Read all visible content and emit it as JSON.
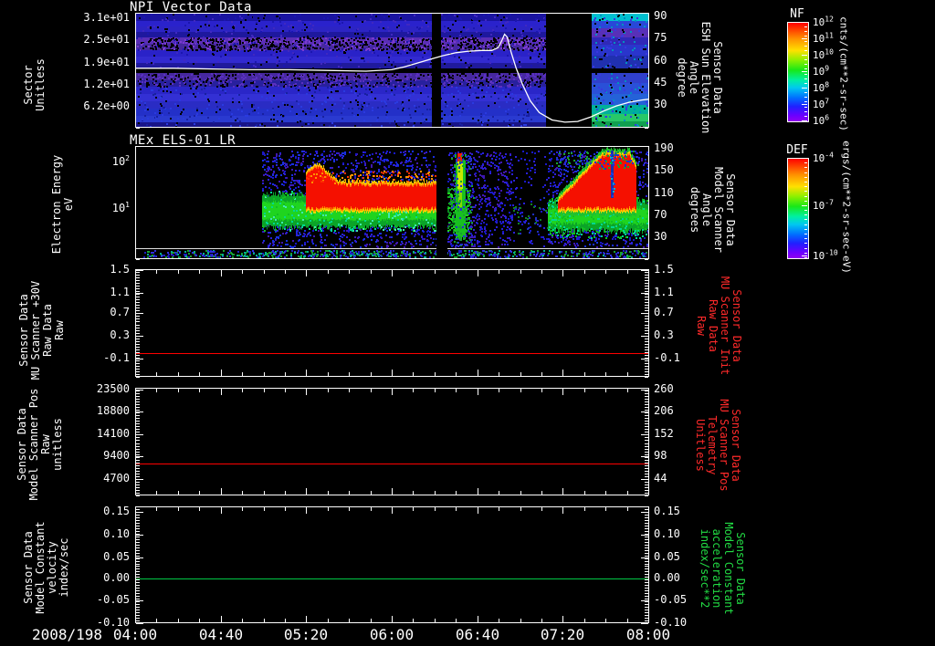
{
  "figure": {
    "bg": "#000000",
    "date_label": "2008/198",
    "time_labels": [
      "04:00",
      "04:40",
      "05:20",
      "06:00",
      "06:40",
      "07:20",
      "08:00"
    ],
    "accent_colors": {
      "white": "#ffffff",
      "red": "#ff2a2a",
      "green": "#22dd44"
    }
  },
  "chart_data": [
    {
      "id": "npi",
      "type": "heatmap",
      "title": "NPI Vector Data",
      "left_axis": {
        "lines": [
          "Sector",
          "Unitless"
        ],
        "ticks": [
          "3.1e+01",
          "2.5e+01",
          "1.9e+01",
          "1.2e+01",
          "6.2e+00"
        ],
        "tick_fracs": [
          0.048,
          0.241,
          0.434,
          0.627,
          0.82
        ],
        "color": "#ffffff"
      },
      "right_axis": {
        "lines": [
          "Sensor Data",
          "ESH Sun Elevation",
          "Angle",
          "degree"
        ],
        "ticks": [
          "90",
          "75",
          "60",
          "45",
          "30"
        ],
        "tick_fracs": [
          0.032,
          0.225,
          0.418,
          0.611,
          0.804
        ],
        "color": "#ffffff"
      },
      "overlay_line": {
        "name": "ESH Sun Elevation Angle",
        "unit": "degree",
        "color": "#ffffff",
        "deg90_frac": 0.032,
        "deg30_frac": 0.804,
        "points": [
          [
            4.0,
            55
          ],
          [
            4.3,
            55
          ],
          [
            4.6,
            54.5
          ],
          [
            4.9,
            54
          ],
          [
            5.2,
            54
          ],
          [
            5.5,
            53.5
          ],
          [
            5.8,
            53
          ],
          [
            6.0,
            54
          ],
          [
            6.1,
            56
          ],
          [
            6.2,
            58.5
          ],
          [
            6.3,
            61
          ],
          [
            6.4,
            63.5
          ],
          [
            6.5,
            65.5
          ],
          [
            6.6,
            66.5
          ],
          [
            6.7,
            67
          ],
          [
            6.78,
            67
          ],
          [
            6.83,
            69
          ],
          [
            6.86,
            74
          ],
          [
            6.88,
            78
          ],
          [
            6.9,
            76
          ],
          [
            6.93,
            66
          ],
          [
            6.97,
            55
          ],
          [
            7.02,
            44
          ],
          [
            7.08,
            33
          ],
          [
            7.15,
            25
          ],
          [
            7.25,
            20
          ],
          [
            7.35,
            18.5
          ],
          [
            7.45,
            19
          ],
          [
            7.55,
            22
          ],
          [
            7.65,
            26
          ],
          [
            7.75,
            29.5
          ],
          [
            7.85,
            32
          ],
          [
            7.95,
            33.5
          ],
          [
            8.0,
            34
          ]
        ]
      },
      "data_gaps_time": [
        [
          "06:19",
          "06:26"
        ],
        [
          "07:12",
          "07:33"
        ]
      ]
    },
    {
      "id": "els",
      "type": "heatmap",
      "title": "MEx ELS-01 LR",
      "left_axis": {
        "lines": [
          "Electron Energy",
          "eV"
        ],
        "scale": "log",
        "ticks": [
          "10^2",
          "10^1"
        ],
        "tick_fracs": [
          0.144,
          0.56
        ],
        "color": "#ffffff"
      },
      "right_axis": {
        "lines": [
          "Sensor Data",
          "Model Scanner",
          "Angle",
          "degrees"
        ],
        "ticks": [
          "190",
          "150",
          "110",
          "70",
          "30"
        ],
        "tick_fracs": [
          0.024,
          0.22,
          0.416,
          0.612,
          0.808
        ],
        "color": "#ffffff"
      },
      "data_start_time": "04:59",
      "hline_frac": 0.903,
      "data_gaps_time": [
        [
          "06:21",
          "06:27"
        ]
      ]
    },
    {
      "id": "mu-scanner-30v",
      "type": "line",
      "left_axis": {
        "lines": [
          "Sensor Data",
          "MU Scanner +30V",
          "Raw Data",
          "Raw"
        ],
        "ticks": [
          "1.5",
          "1.1",
          "0.7",
          "0.3",
          "-0.1"
        ],
        "tick_fracs": [
          0.008,
          0.22,
          0.407,
          0.619,
          0.831
        ],
        "color": "#ffffff"
      },
      "right_axis": {
        "lines": [
          "Sensor Data",
          "MU Scanner Init",
          "Raw Data",
          "Raw"
        ],
        "ticks": [
          "1.5",
          "1.1",
          "0.7",
          "0.3",
          "-0.1"
        ],
        "tick_fracs": [
          0.008,
          0.22,
          0.407,
          0.619,
          0.831
        ],
        "color": "#ff2a2a"
      },
      "series": [
        {
          "name": "MU Scanner +30V Raw",
          "color": "#ff0000",
          "constant_value": 0.0,
          "y_frac": 0.78
        }
      ]
    },
    {
      "id": "model-scanner-pos",
      "type": "line",
      "left_axis": {
        "lines": [
          "Sensor Data",
          "Model Scanner Pos",
          "Raw",
          "unitless"
        ],
        "ticks": [
          "23500",
          "18800",
          "14100",
          "9400",
          "4700"
        ],
        "tick_fracs": [
          0.017,
          0.224,
          0.432,
          0.639,
          0.847
        ],
        "color": "#ffffff"
      },
      "right_axis": {
        "lines": [
          "Sensor Data",
          "MU Scanner Pos",
          "Telemetry",
          "Unitless"
        ],
        "ticks": [
          "260",
          "206",
          "152",
          "98",
          "44"
        ],
        "tick_fracs": [
          0.017,
          0.224,
          0.432,
          0.639,
          0.847
        ],
        "color": "#ff2a2a"
      },
      "series": [
        {
          "name": "Model Scanner Pos Raw",
          "color": "#ff0000",
          "constant_value": 8000,
          "y_frac": 0.703
        }
      ]
    },
    {
      "id": "model-constant-velocity",
      "type": "line",
      "left_axis": {
        "lines": [
          "Sensor Data",
          "Model Constant",
          "velocity",
          "index/sec"
        ],
        "ticks": [
          "0.15",
          "0.10",
          "0.05",
          "0.00",
          "-0.05",
          "-0.10"
        ],
        "tick_fracs": [
          0.047,
          0.242,
          0.438,
          0.617,
          0.805,
          1.0
        ],
        "color": "#ffffff"
      },
      "right_axis": {
        "lines": [
          "Sensor Data",
          "Model Constant",
          "acceleration",
          "index/sec**2"
        ],
        "ticks": [
          "0.15",
          "0.10",
          "0.05",
          "0.00",
          "-0.05",
          "-0.10"
        ],
        "tick_fracs": [
          0.047,
          0.242,
          0.438,
          0.617,
          0.805,
          1.0
        ],
        "color": "#22dd44"
      },
      "series": [
        {
          "name": "Model Constant velocity",
          "color": "#00c846",
          "constant_value": 0.0,
          "y_frac": 0.617
        }
      ]
    }
  ],
  "colorbars": [
    {
      "id": "nf",
      "title": "NF",
      "unit": "cnts/(cm**2-sr-sec)",
      "ticks": [
        "10^12",
        "10^11",
        "10^10",
        "10^9",
        "10^8",
        "10^7",
        "10^6"
      ],
      "tick_fracs": [
        0,
        0.1667,
        0.3333,
        0.5,
        0.6667,
        0.8333,
        1.0
      ]
    },
    {
      "id": "def",
      "title": "DEF",
      "unit": "ergs/(cm**2-sr-sec-eV)",
      "ticks": [
        "10^-4",
        "10^-7",
        "10^-10"
      ],
      "tick_fracs": [
        0,
        0.477,
        0.982
      ]
    }
  ]
}
